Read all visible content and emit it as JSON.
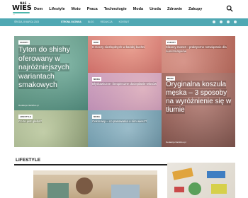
{
  "logo": {
    "top": "NAS",
    "main": "WIEŚ",
    "sub": "..."
  },
  "nav": {
    "items": [
      "Dom",
      "Lifestyle",
      "Moto",
      "Praca",
      "Technologie",
      "Moda",
      "Uroda",
      "Zdrowie",
      "Zakupy"
    ]
  },
  "topbar": {
    "date": "ŚRODA, 8 MARCA 2023",
    "links": [
      "STRONA GŁÓWNA",
      "BLOG",
      "REDAKCJA",
      "KONTAKT"
    ]
  },
  "grid": {
    "t1": {
      "category": "ZAKUPY",
      "title": "Tyton do shishy oferowany w najróżniejszych wariantach smakowych",
      "meta": "Redakcja NasWies.pl"
    },
    "t2": {
      "category": "DOM",
      "title": "8 rzeczy niezbędnych w każdej kuchni"
    },
    "t3": {
      "category": "ZAKUPY",
      "title": "Klasery monet – praktyczne rozwiązanie dla numizmatyków"
    },
    "t4": {
      "category": "MODA",
      "title": "Błyskawiczne i bezpieczne docieplanie włosów"
    },
    "t5": {
      "category": "MODA",
      "title": "Oryginalna koszula męska – 3 sposoby na wyróżnienie się w tłumie",
      "meta": "Redakcja NasWies.pl"
    },
    "t6": {
      "category": "LIFESTYLE",
      "title": "Co to jest gleba?"
    },
    "t7": {
      "category": "MODA",
      "title": "Cekinowy – co pasowania o nim wiesz?"
    }
  },
  "section": {
    "title": "LIFESTYLE"
  },
  "colors": {
    "accent": "#4fa8b3",
    "text": "#111111"
  }
}
